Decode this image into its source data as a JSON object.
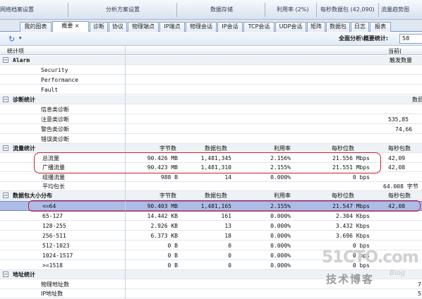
{
  "toolbar": {
    "items": [
      "网络档案设置",
      "分析方案设置",
      "数据存储",
      "利用率 (2%)",
      "每秒数据包 (42,090)",
      "流量趋势图"
    ]
  },
  "tabs": [
    {
      "label": "我的图表"
    },
    {
      "label": "概要 ×"
    },
    {
      "label": "诊断"
    },
    {
      "label": "协议"
    },
    {
      "label": "物理端点"
    },
    {
      "label": "IP端点"
    },
    {
      "label": "物理会话"
    },
    {
      "label": "IP会话"
    },
    {
      "label": "TCP会话"
    },
    {
      "label": "UDP会话"
    },
    {
      "label": "矩阵"
    },
    {
      "label": "数据包"
    },
    {
      "label": "日志"
    },
    {
      "label": "报表"
    }
  ],
  "subbar": {
    "refresh_icon": "refresh-icon",
    "dropdown_glyph": "▾",
    "path_label": "全面分析\\概要统计:",
    "path_value": "58"
  },
  "grid": {
    "header_left": "统计项",
    "header_right": "当前(",
    "sections": {
      "alarm": {
        "title": "Alarm",
        "right": "触发数量",
        "items": [
          "Security",
          "Performance",
          "Fault"
        ]
      },
      "diag": {
        "title": "诊断统计",
        "right": "数目",
        "items": [
          {
            "label": "信息类诊断",
            "value": ""
          },
          {
            "label": "注意类诊断",
            "value": "535,85"
          },
          {
            "label": "警告类诊断",
            "value": "74,66"
          },
          {
            "label": "错误类诊断",
            "value": ""
          }
        ]
      },
      "traffic": {
        "title": "流量统计",
        "cols": [
          "字节数",
          "数据包数",
          "利用率",
          "每秒位数",
          "每秒包数"
        ],
        "rows": [
          {
            "label": "总流量",
            "bytes": "90.426 MB",
            "packets": "1,481,345",
            "util": "2.156%",
            "bps": "21.556 Mbps",
            "pps": "42,09"
          },
          {
            "label": "广播流量",
            "bytes": "90.423 MB",
            "packets": "1,481,310",
            "util": "2.155%",
            "bps": "21.551 Mbps",
            "pps": "42,08"
          },
          {
            "label": "组播流量",
            "bytes": "988 B",
            "packets": "14",
            "util": "0.000%",
            "bps": "0 bps",
            "pps": ""
          },
          {
            "label": "平均包长",
            "bytes": "",
            "packets": "",
            "util": "",
            "bps": "",
            "pps": "64.008 字节"
          }
        ]
      },
      "sizes": {
        "title": "数据包大小分布",
        "cols": [
          "字节数",
          "数据包数",
          "利用率",
          "每秒位数",
          "每秒包数"
        ],
        "rows": [
          {
            "label": "<=64",
            "bytes": "90.403 MB",
            "packets": "1,481,165",
            "util": "2.155%",
            "bps": "21.547 Mbps",
            "pps": "42,08"
          },
          {
            "label": "65-127",
            "bytes": "14.442 KB",
            "packets": "161",
            "util": "0.000%",
            "bps": "2.304 Kbps",
            "pps": ""
          },
          {
            "label": "128-255",
            "bytes": "2.926 KB",
            "packets": "13",
            "util": "0.000%",
            "bps": "3.432 Kbps",
            "pps": ""
          },
          {
            "label": "256-511",
            "bytes": "6.373 KB",
            "packets": "18",
            "util": "0.000%",
            "bps": "3.696 Kbps",
            "pps": ""
          },
          {
            "label": "512-1023",
            "bytes": "0 B",
            "packets": "0",
            "util": "0.000%",
            "bps": "0 bps",
            "pps": ""
          },
          {
            "label": "1024-1517",
            "bytes": "0 B",
            "packets": "0",
            "util": "0.000%",
            "bps": "0 bps",
            "pps": ""
          },
          {
            "label": ">=1518",
            "bytes": "0 B",
            "packets": "0",
            "util": "0.000%",
            "bps": "0 bps",
            "pps": ""
          }
        ]
      },
      "address": {
        "title": "地址统计",
        "items": [
          {
            "label": "物理地址数",
            "value": "7"
          },
          {
            "label": "IP地址数",
            "value": "5"
          }
        ]
      }
    }
  },
  "watermark": {
    "main": "51CTO.com",
    "sub": "技术博客",
    "blog": "Blog"
  },
  "colors": {
    "highlight_oval": "#cc1e2e",
    "selected_row": "#aebde8",
    "tab_border": "#8aa3c2"
  }
}
